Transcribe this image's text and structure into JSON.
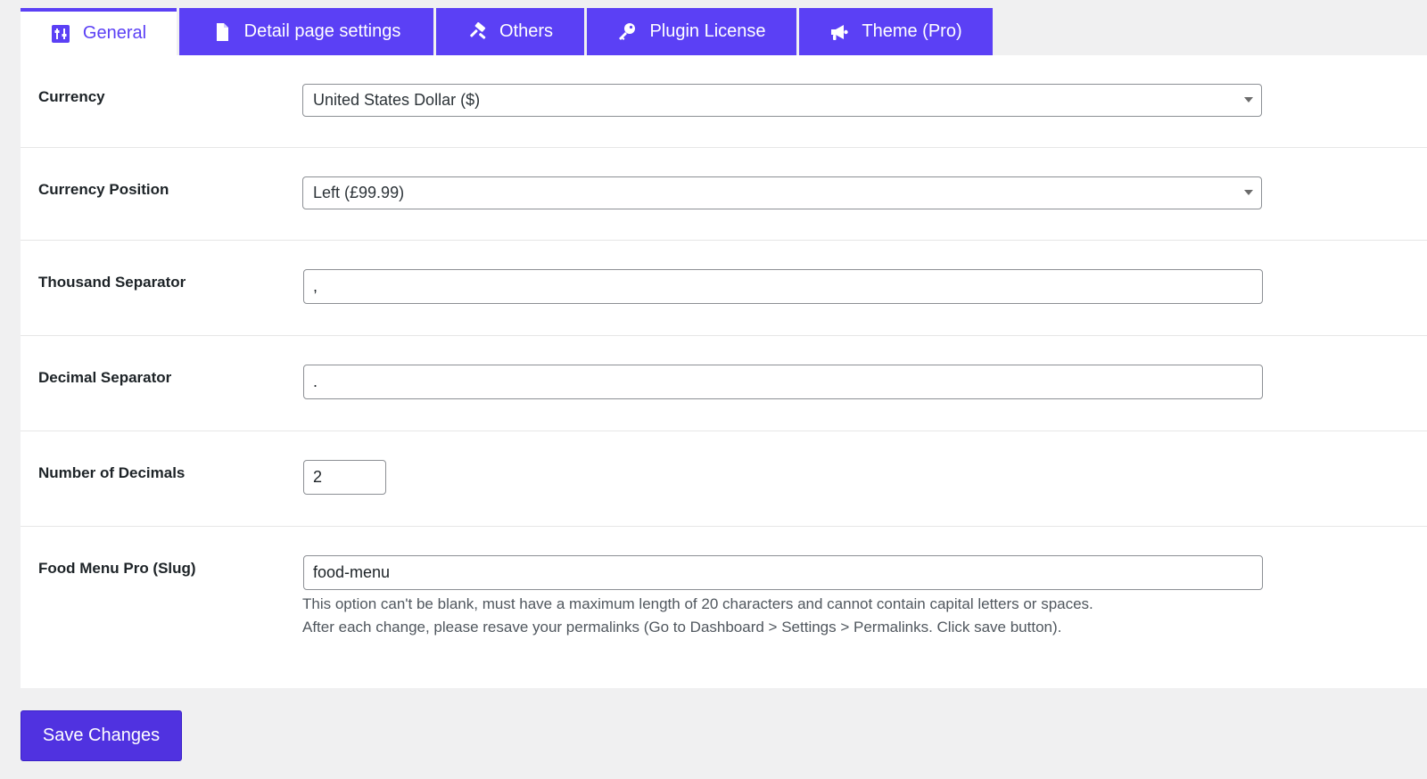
{
  "colors": {
    "accent": "#5b40f5",
    "save_button": "#5032e0",
    "background": "#f0f0f1",
    "panel": "#ffffff"
  },
  "tabs": [
    {
      "label": "General",
      "icon": "sliders-icon",
      "active": true
    },
    {
      "label": "Detail page settings",
      "icon": "document-icon",
      "active": false
    },
    {
      "label": "Others",
      "icon": "hammer-icon",
      "active": false
    },
    {
      "label": "Plugin License",
      "icon": "key-icon",
      "active": false
    },
    {
      "label": "Theme (Pro)",
      "icon": "megaphone-icon",
      "active": false
    }
  ],
  "settings": {
    "currency": {
      "label": "Currency",
      "value": "United States Dollar ($)"
    },
    "currency_position": {
      "label": "Currency Position",
      "value": "Left (£99.99)"
    },
    "thousand_separator": {
      "label": "Thousand Separator",
      "value": ","
    },
    "decimal_separator": {
      "label": "Decimal Separator",
      "value": "."
    },
    "number_of_decimals": {
      "label": "Number of Decimals",
      "value": "2"
    },
    "slug": {
      "label": "Food Menu Pro (Slug)",
      "value": "food-menu",
      "help_line1": "This option can't be blank, must have a maximum length of 20 characters and cannot contain capital letters or spaces.",
      "help_line2": "After each change, please resave your permalinks (Go to Dashboard > Settings > Permalinks. Click save button)."
    }
  },
  "save_button": {
    "label": "Save Changes"
  }
}
